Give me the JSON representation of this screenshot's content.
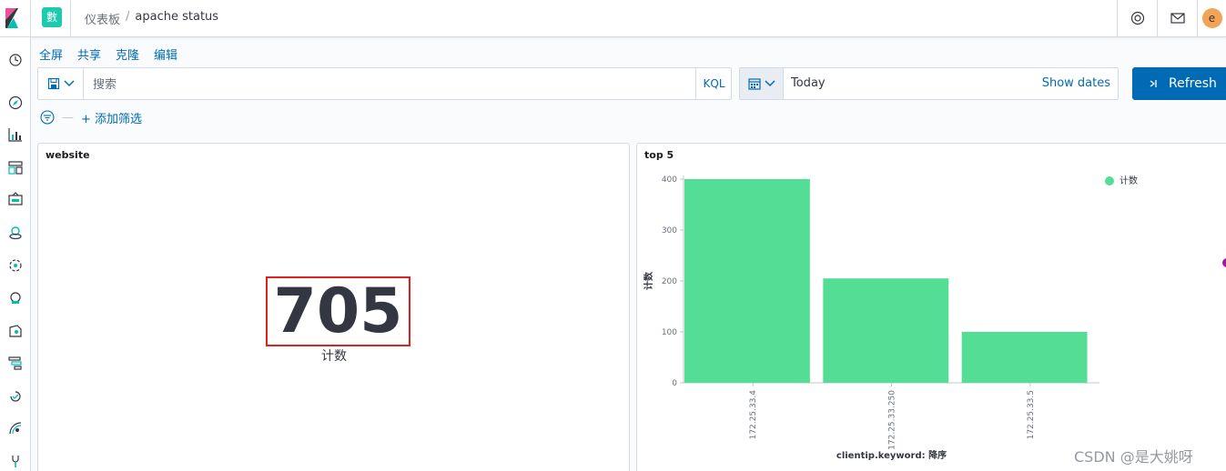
{
  "header": {
    "space_initial": "數",
    "breadcrumb_root": "仪表板",
    "breadcrumb_sep": "/",
    "breadcrumb_current": "apache status",
    "user_initial": "e"
  },
  "sidebar": {
    "icons": [
      "clock-icon",
      "discover-icon",
      "visualize-icon",
      "dashboard-icon",
      "canvas-icon",
      "maps-icon",
      "ml-icon",
      "infrastructure-icon",
      "logs-icon",
      "apm-icon",
      "uptime-icon",
      "monitoring-icon",
      "devtools-icon"
    ]
  },
  "top_nav": {
    "items": [
      "全屏",
      "共享",
      "克隆",
      "编辑"
    ]
  },
  "query_bar": {
    "placeholder": "搜索",
    "language": "KQL"
  },
  "date_picker": {
    "value": "Today",
    "show_dates": "Show dates"
  },
  "refresh": {
    "label": "Refresh"
  },
  "filter_bar": {
    "add_filter": "+ 添加筛选"
  },
  "panels": {
    "website": {
      "title": "website",
      "value": "705",
      "label": "计数"
    },
    "top5": {
      "title": "top 5"
    }
  },
  "chart_data": {
    "type": "bar",
    "categories": [
      "172.25.33.4",
      "172.25.33.250",
      "172.25.33.5"
    ],
    "series": [
      {
        "name": "计数",
        "values": [
          400,
          205,
          100
        ],
        "color": "#54dd94"
      }
    ],
    "xlabel": "clientip.keyword: 降序",
    "ylabel": "计数",
    "ylim": [
      0,
      400
    ],
    "yticks": [
      0,
      100,
      200,
      300,
      400
    ],
    "legend": "top-right",
    "grid": false
  },
  "watermark": "CSDN @是大姚呀",
  "colors": {
    "accent": "#006bb4",
    "space": "#1bcbac",
    "bar": "#54dd94",
    "highlight": "#e02020"
  }
}
